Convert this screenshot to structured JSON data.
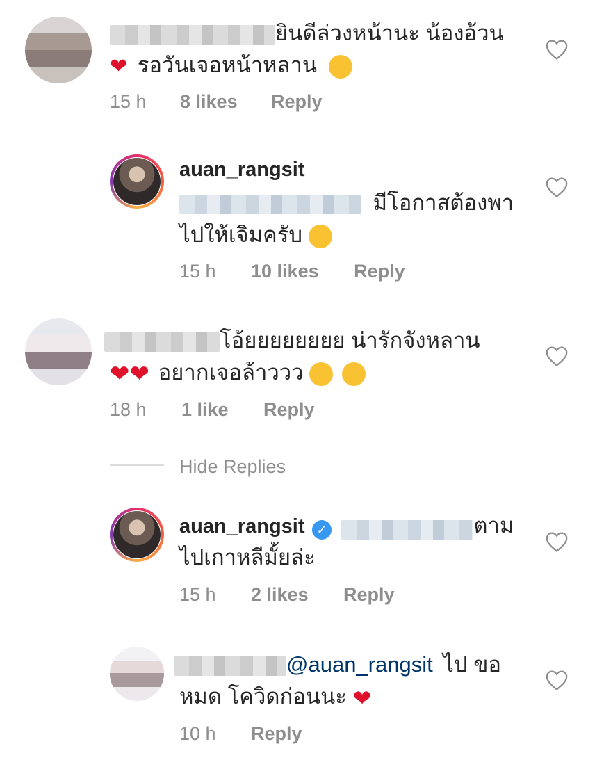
{
  "comments": [
    {
      "text_line1": "ยินดีล่วงหน้านะ น้องอ้วน",
      "text_line2": "รอวันเจอหน้าหลาน",
      "time": "15 h",
      "likes": "8 likes",
      "reply": "Reply"
    },
    {
      "username": "auan_rangsit",
      "text_line1": "มีโอกาสต้องพา",
      "text_line2": "ไปให้เจิมครับ",
      "time": "15 h",
      "likes": "10 likes",
      "reply": "Reply"
    },
    {
      "text_line1": "โอ้ยยยยยยยย น่ารักจังหลาน",
      "text_line2": "อยากเจอล้าววว",
      "time": "18 h",
      "likes": "1 like",
      "reply": "Reply"
    },
    {
      "hide_replies": "Hide Replies"
    },
    {
      "username": "auan_rangsit",
      "text_line1": "ตาม",
      "text_line2": "ไปเกาหลีมั้ยล่ะ",
      "time": "15 h",
      "likes": "2 likes",
      "reply": "Reply"
    },
    {
      "mention": "@auan_rangsit",
      "text_line1": "ไป ขอ",
      "text_line2": "หมด โควิดก่อนนะ",
      "time": "10 h",
      "reply": "Reply"
    }
  ],
  "icons": {
    "like": "heart-outline-icon",
    "verified": "verified-badge-icon"
  },
  "colors": {
    "text": "#262626",
    "meta": "#8e8e8e",
    "mention": "#00376b",
    "verified": "#3897f0",
    "heart": "#e0112b"
  }
}
